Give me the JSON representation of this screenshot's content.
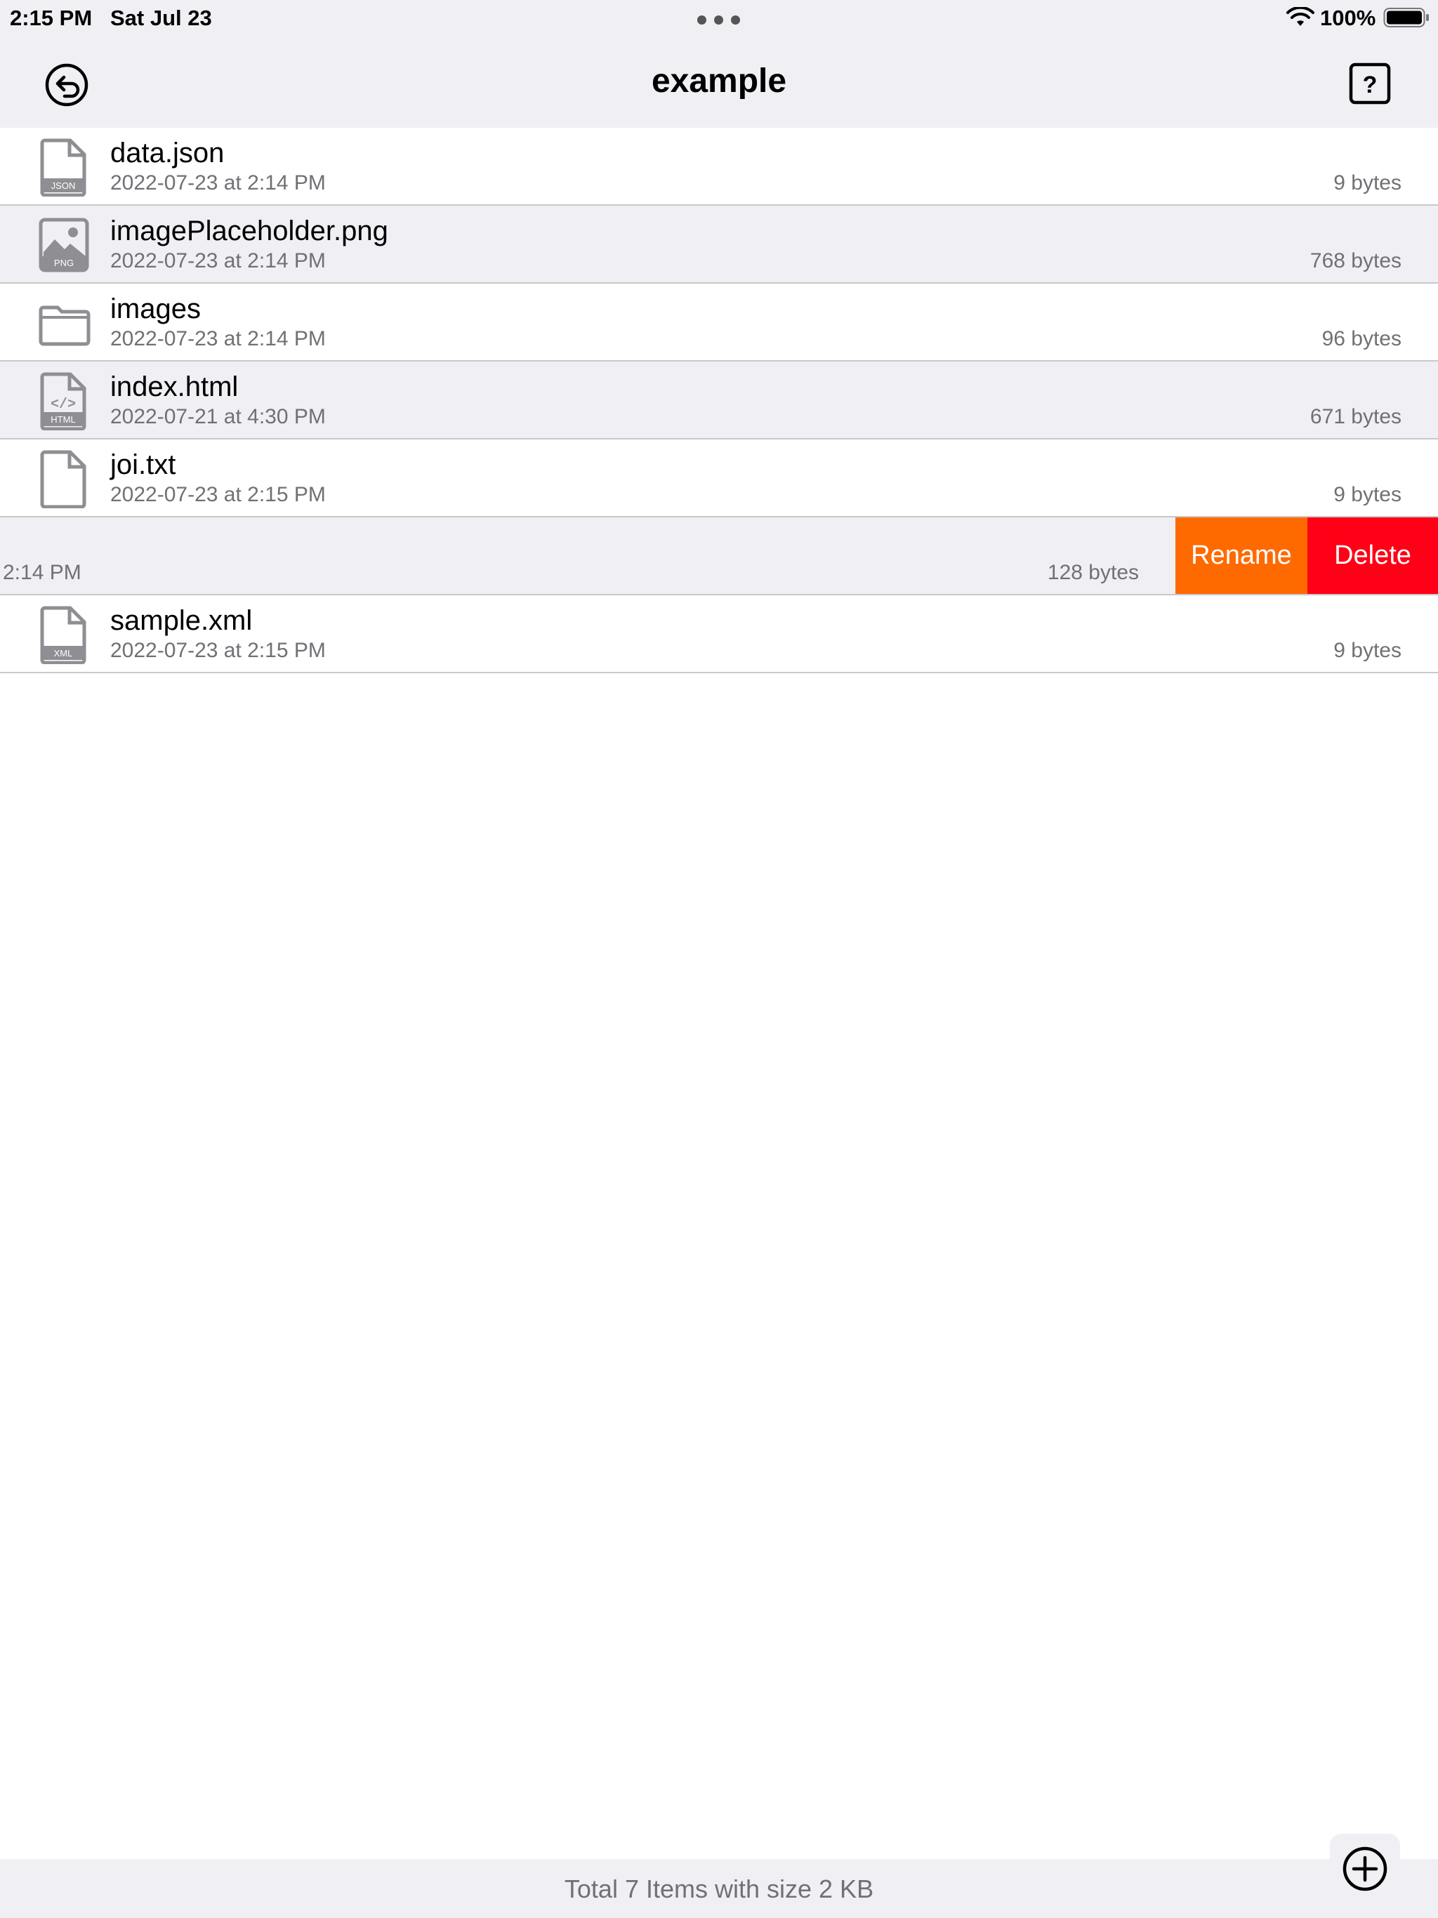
{
  "status_bar": {
    "time": "2:15 PM",
    "date": "Sat Jul 23",
    "battery": "100%",
    "icons": [
      "multitask-dots-icon",
      "wifi-icon",
      "battery-icon"
    ]
  },
  "navbar": {
    "title": "example",
    "back_icon": "undo-circle-icon",
    "help_icon": "help-box-icon"
  },
  "files": [
    {
      "name": "data.json",
      "date": "2022-07-23 at 2:14 PM",
      "size": "9 bytes",
      "icon": "json-file-icon",
      "shade": "white"
    },
    {
      "name": "imagePlaceholder.png",
      "date": "2022-07-23 at 2:14 PM",
      "size": "768 bytes",
      "icon": "png-image-file-icon",
      "shade": "gray"
    },
    {
      "name": "images",
      "date": "2022-07-23 at 2:14 PM",
      "size": "96 bytes",
      "icon": "folder-icon",
      "shade": "white"
    },
    {
      "name": "index.html",
      "date": "2022-07-21 at 4:30 PM",
      "size": "671 bytes",
      "icon": "html-file-icon",
      "shade": "gray"
    },
    {
      "name": "joi.txt",
      "date": "2022-07-23 at 2:15 PM",
      "size": "9 bytes",
      "icon": "text-file-icon",
      "shade": "white"
    },
    {
      "name": "",
      "date": "2:14 PM",
      "size": "128 bytes",
      "icon": "",
      "shade": "gray",
      "swiped": true
    },
    {
      "name": "sample.xml",
      "date": "2022-07-23 at 2:15 PM",
      "size": "9 bytes",
      "icon": "xml-file-icon",
      "shade": "white"
    }
  ],
  "swipe_actions": {
    "rename": "Rename",
    "delete": "Delete"
  },
  "footer": {
    "summary": "Total 7 Items with size 2 KB",
    "add_icon": "plus-circle-icon"
  },
  "colors": {
    "bar_background": "#efeff4",
    "secondary_text": "#707075",
    "rename": "#ff6a00",
    "delete": "#ff0016",
    "icon_gray": "#8e8e93"
  }
}
